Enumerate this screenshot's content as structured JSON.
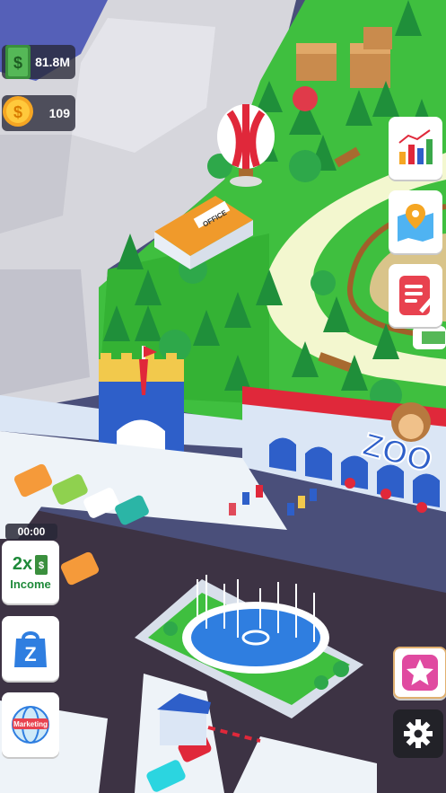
{
  "hud": {
    "cash_value": "81.8M",
    "coin_value": "109",
    "cash_icon": "dollar-bill-icon",
    "coin_icon": "coin-icon"
  },
  "right_menu": [
    {
      "name": "stats-button",
      "icon": "bar-chart-icon"
    },
    {
      "name": "map-button",
      "icon": "map-pin-icon"
    },
    {
      "name": "tasks-button",
      "icon": "notepad-icon"
    },
    {
      "name": "favorites-button",
      "icon": "star-icon"
    },
    {
      "name": "settings-button",
      "icon": "gear-icon"
    }
  ],
  "left_menu": {
    "timer": "00:00",
    "income_multiplier": "2x",
    "income_label": "Income",
    "shop_icon": "shopping-bag-icon",
    "marketing_label": "Marketing"
  },
  "scene": {
    "office_sign": "OFFICE",
    "zoo_sign": "ZOO"
  },
  "colors": {
    "grass": "#3fbf3f",
    "path": "#f3f7cf",
    "road": "#3d3344",
    "fountain_water": "#2f7ee0",
    "zoo_red": "#e0283a",
    "wall_blue": "#2e5fc9"
  }
}
